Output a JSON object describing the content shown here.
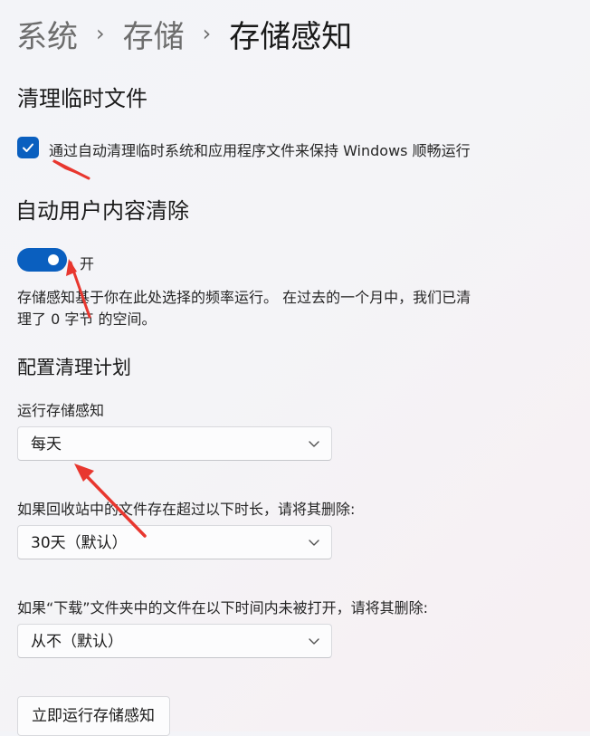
{
  "breadcrumb": {
    "items": [
      "系统",
      "存储"
    ],
    "current": "存储感知",
    "separator": "›"
  },
  "temp_files": {
    "title": "清理临时文件",
    "checkbox_label": "通过自动清理临时系统和应用程序文件来保持 Windows 顺畅运行",
    "checked": true
  },
  "auto_cleanup": {
    "title": "自动用户内容清除",
    "toggle_state_label": "开",
    "toggle_on": true,
    "description_line1": "存储感知基于你在此处选择的频率运行。 在过去的一个月中，我们已清",
    "description_line2": "理了 0 字节 的空间。"
  },
  "schedule": {
    "title": "配置清理计划",
    "run_label": "运行存储感知",
    "run_value": "每天",
    "recycle_label": "如果回收站中的文件存在超过以下时长，请将其删除:",
    "recycle_value": "30天（默认）",
    "downloads_label": "如果“下载”文件夹中的文件在以下时间内未被打开，请将其删除:",
    "downloads_value": "从不（默认）",
    "run_now_label": "立即运行存储感知"
  },
  "colors": {
    "accent": "#0a5fbf",
    "annotation_arrow": "#e8372f"
  }
}
